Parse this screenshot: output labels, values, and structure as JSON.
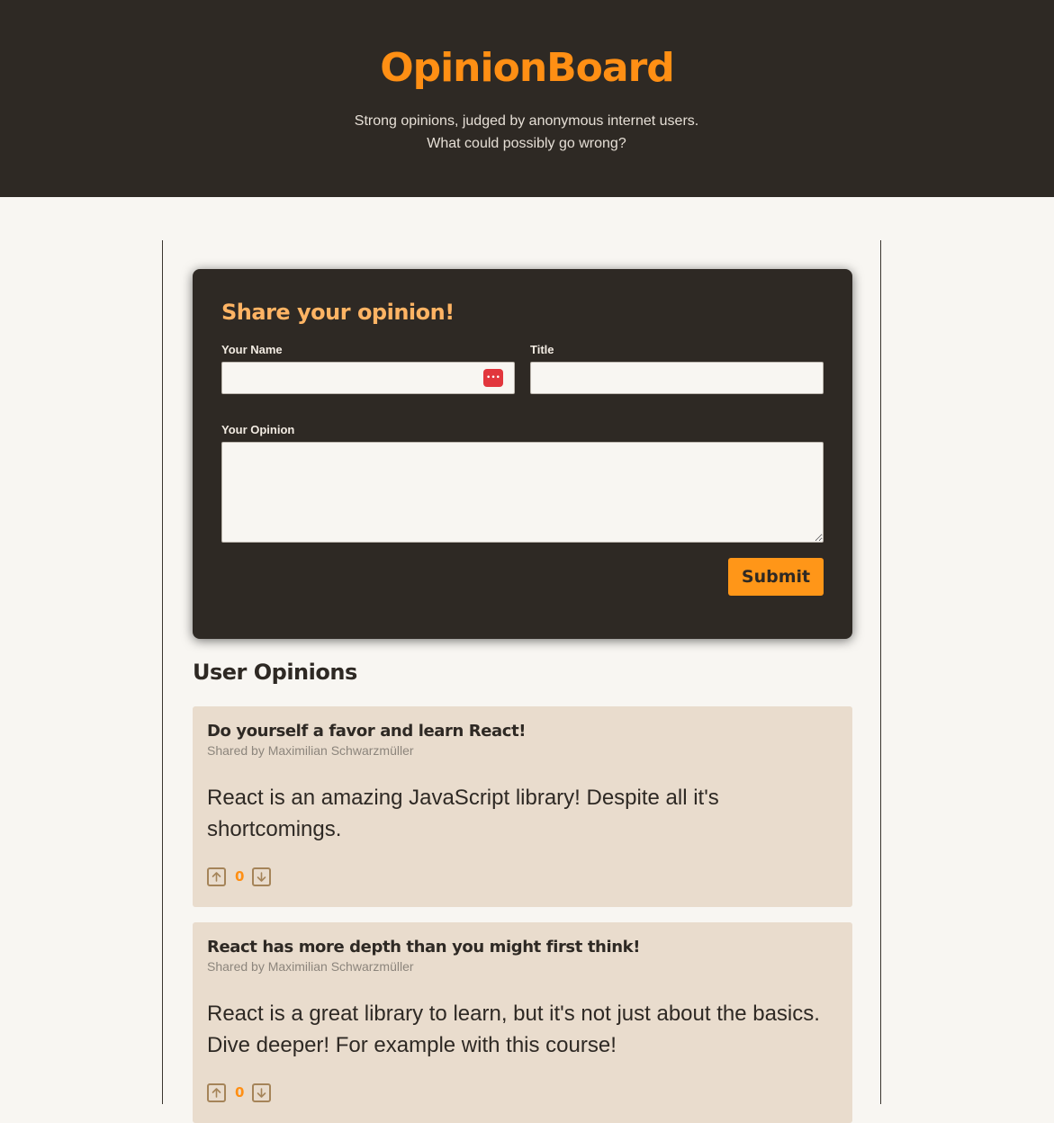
{
  "header": {
    "brand": "OpinionBoard",
    "tagline": "Strong opinions, judged by anonymous internet users. What could possibly go wrong?"
  },
  "form": {
    "title": "Share your opinion!",
    "name_label": "Your Name",
    "name_value": "",
    "password_manager_badge": "•••",
    "title_label": "Title",
    "title_value": "",
    "opinion_label": "Your Opinion",
    "opinion_value": "",
    "submit_label": "Submit"
  },
  "opinions": {
    "heading": "User Opinions",
    "items": [
      {
        "title": "Do yourself a favor and learn React!",
        "author": "Shared by Maximilian Schwarzmüller",
        "body": "React is an amazing JavaScript library! Despite all it's shortcomings.",
        "votes": "0"
      },
      {
        "title": "React has more depth than you might first think!",
        "author": "Shared by Maximilian Schwarzmüller",
        "body": "React is a great library to learn, but it's not just about the basics. Dive deeper! For example with this course!",
        "votes": "0"
      }
    ]
  },
  "icons": {
    "upvote": "arrow-up-icon",
    "downvote": "arrow-down-icon",
    "password_manager": "password-manager-icon"
  },
  "colors": {
    "header_bg": "#2e2924",
    "brand_orange": "#ff8f14",
    "form_title": "#ffb464",
    "card_bg": "#e9dccd",
    "page_bg": "#f8f6f2"
  }
}
